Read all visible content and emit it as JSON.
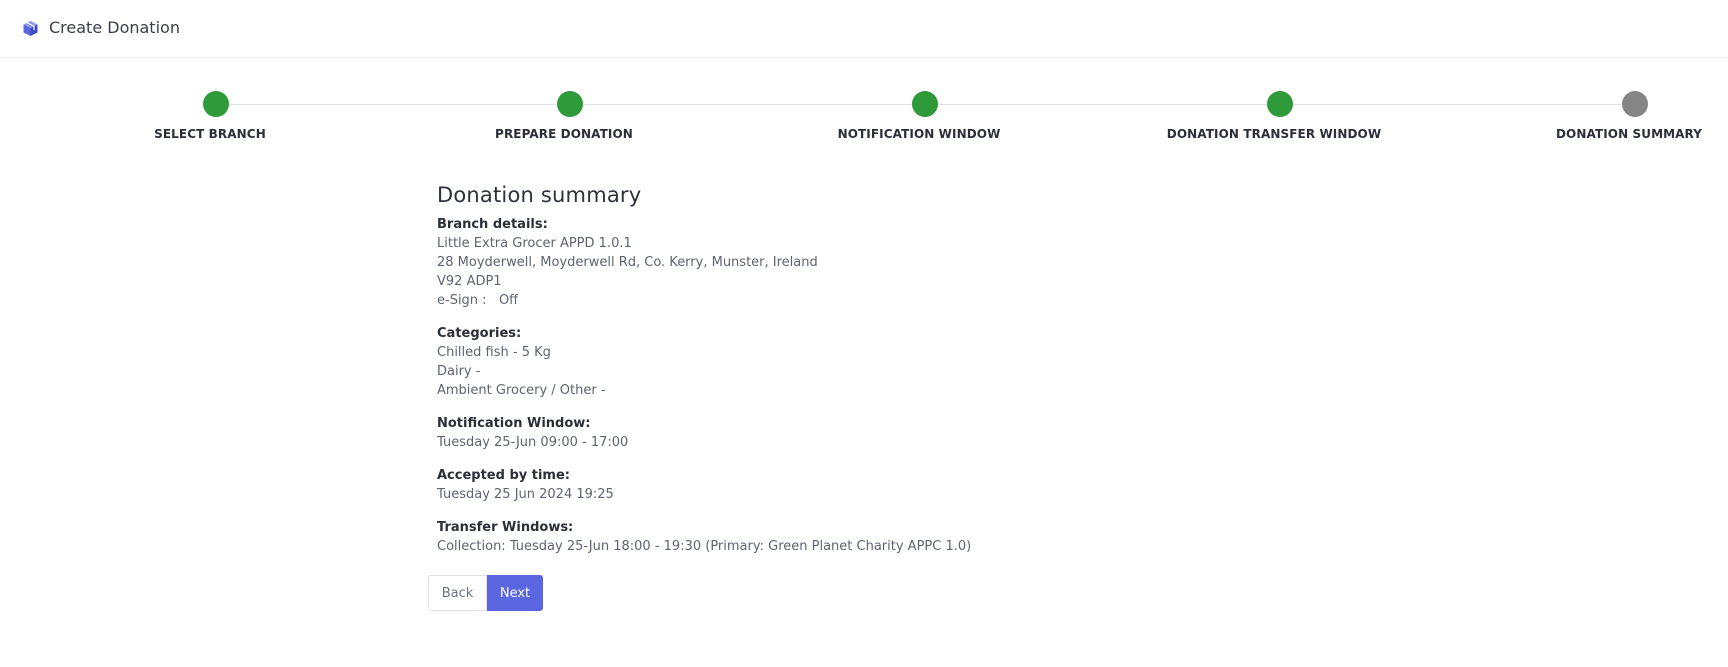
{
  "header": {
    "title": "Create Donation",
    "icon": "cube-icon",
    "icon_color": "#5b67e0"
  },
  "stepper": {
    "complete_color": "#2e9a3a",
    "pending_color": "#858585",
    "steps": [
      {
        "label": "SELECT BRANCH",
        "state": "complete"
      },
      {
        "label": "PREPARE DONATION",
        "state": "complete"
      },
      {
        "label": "NOTIFICATION WINDOW",
        "state": "complete"
      },
      {
        "label": "DONATION TRANSFER WINDOW",
        "state": "complete"
      },
      {
        "label": "DONATION SUMMARY",
        "state": "pending"
      }
    ]
  },
  "summary": {
    "title": "Donation summary",
    "branch": {
      "heading": "Branch details:",
      "name": "Little Extra Grocer APPD 1.0.1",
      "address": "28 Moyderwell, Moyderwell Rd, Co. Kerry, Munster, Ireland",
      "postcode": "V92 ADP1",
      "esign": "e-Sign :   Off"
    },
    "categories": {
      "heading": "Categories:",
      "items": [
        "Chilled fish - 5 Kg",
        "Dairy -",
        "Ambient Grocery / Other -"
      ]
    },
    "notification": {
      "heading": "Notification Window:",
      "value": "Tuesday 25-Jun 09:00 - 17:00"
    },
    "accepted": {
      "heading": "Accepted by time:",
      "value": "Tuesday 25 Jun 2024 19:25"
    },
    "transfer": {
      "heading": "Transfer Windows:",
      "value": "Collection: Tuesday 25-Jun 18:00 - 19:30 (Primary: Green Planet Charity APPC 1.0)"
    }
  },
  "actions": {
    "back_label": "Back",
    "next_label": "Next",
    "next_color": "#5b67e0"
  }
}
